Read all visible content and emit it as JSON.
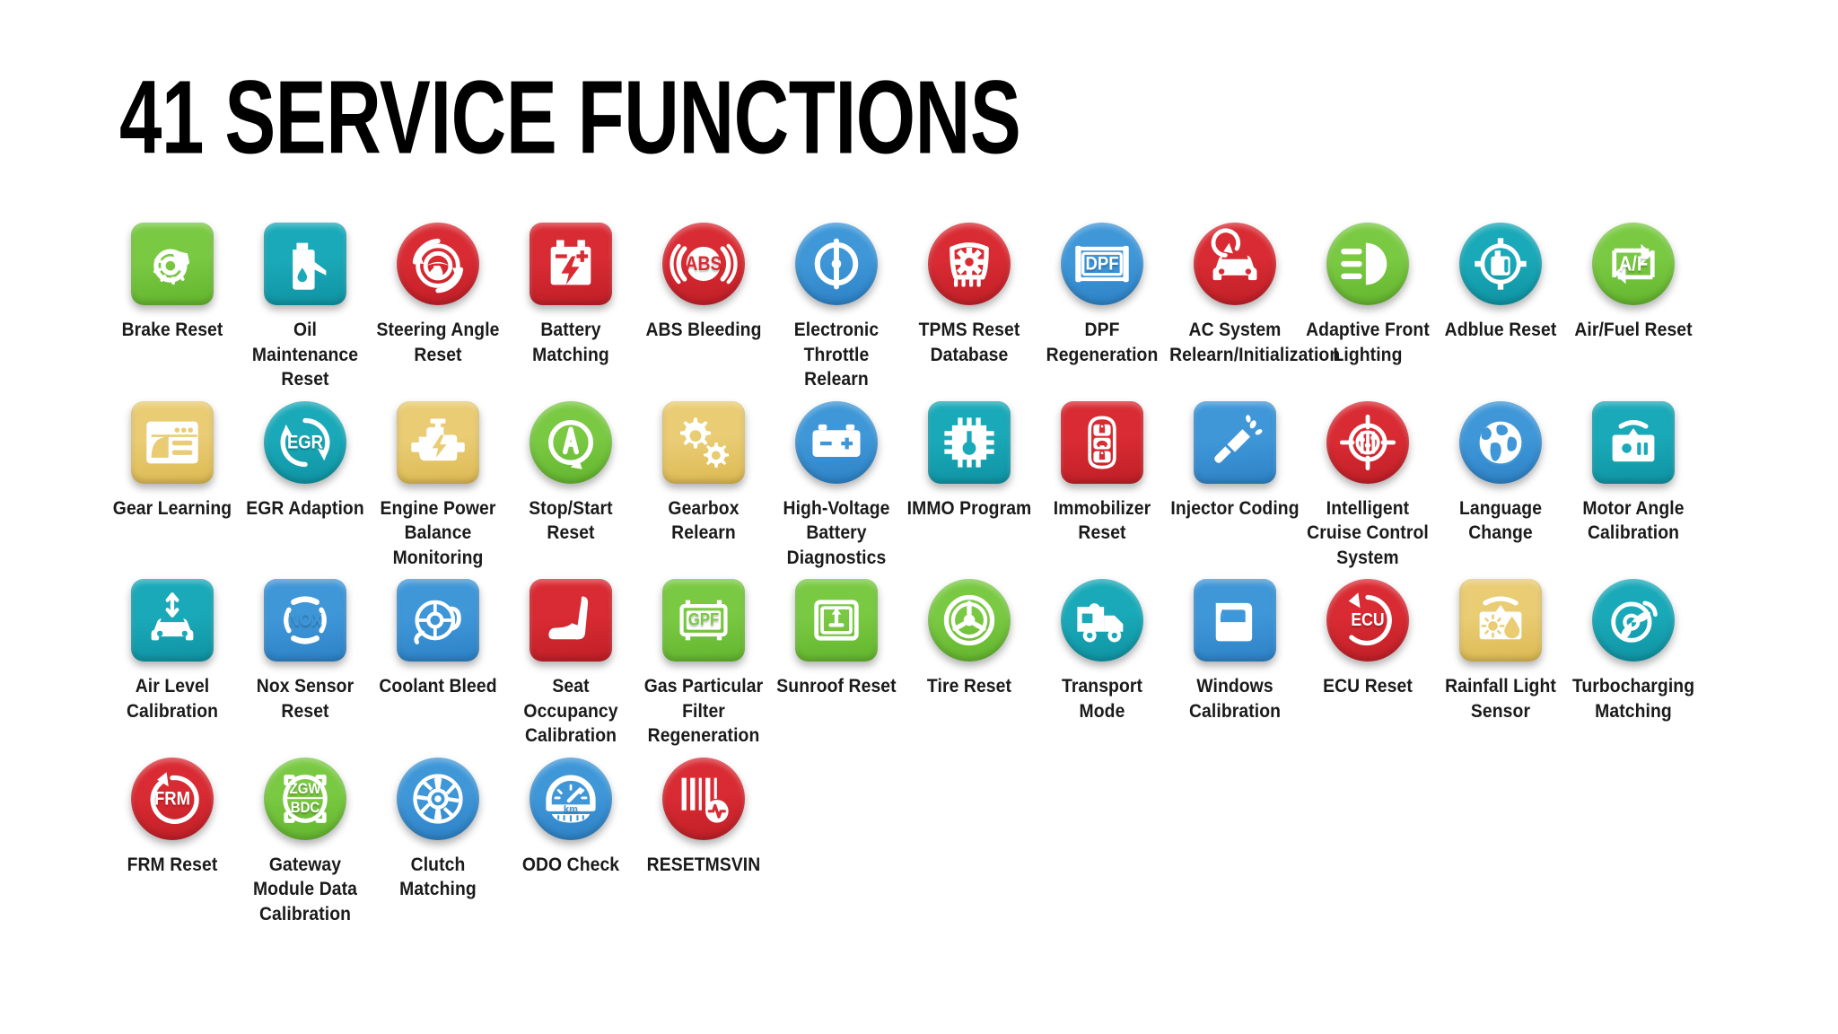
{
  "page": {
    "title": "41 SERVICE FUNCTIONS",
    "background": "#ffffff",
    "text_color": "#1a1a1a"
  },
  "palette": {
    "green": "#7ac943",
    "green_dark": "#63b52e",
    "blue": "#3f97d8",
    "blue_dark": "#2d82c6",
    "red": "#d92b33",
    "red_dark": "#c01f27",
    "teal": "#1aa9b8",
    "teal_dark": "#0f93a3",
    "gold": "#e9cc74",
    "gold_dark": "#dcb952",
    "glyph": "#ffffff"
  },
  "rows": [
    {
      "index": 1,
      "items": [
        {
          "label": "Brake Reset",
          "icon": "brake-disc-icon",
          "color": "green",
          "shape": "square"
        },
        {
          "label": "Oil Maintenance Reset",
          "icon": "oil-can-icon",
          "color": "teal",
          "shape": "square"
        },
        {
          "label": "Steering Angle Reset",
          "icon": "steering-wheel-reset-icon",
          "color": "red",
          "shape": "circle"
        },
        {
          "label": "Battery Matching",
          "icon": "battery-icon",
          "color": "red",
          "shape": "square"
        },
        {
          "label": "ABS Bleeding",
          "icon": "abs-icon",
          "color": "red",
          "shape": "circle",
          "text": "ABS"
        },
        {
          "label": "Electronic Throttle Relearn",
          "icon": "throttle-body-icon",
          "color": "blue",
          "shape": "circle"
        },
        {
          "label": "TPMS Reset Database",
          "icon": "tire-pressure-icon",
          "color": "red",
          "shape": "circle"
        },
        {
          "label": "DPF Regeneration",
          "icon": "dpf-filter-icon",
          "color": "blue",
          "shape": "circle",
          "text": "DPF"
        },
        {
          "label": "AC System Relearn/Initialization",
          "icon": "ac-car-icon",
          "color": "red",
          "shape": "circle"
        },
        {
          "label": "Adaptive Front Lighting",
          "icon": "headlight-icon",
          "color": "green",
          "shape": "circle"
        },
        {
          "label": "Adblue Reset",
          "icon": "adblue-tank-icon",
          "color": "teal",
          "shape": "circle"
        },
        {
          "label": "Air/Fuel Reset",
          "icon": "air-fuel-icon",
          "color": "green",
          "shape": "circle",
          "text": "A/F"
        }
      ]
    },
    {
      "index": 2,
      "items": [
        {
          "label": "Gear Learning",
          "icon": "gear-learning-screen-icon",
          "color": "gold",
          "shape": "square"
        },
        {
          "label": "EGR Adaption",
          "icon": "egr-icon",
          "color": "teal",
          "shape": "circle",
          "text": "EGR"
        },
        {
          "label": "Engine Power Balance Monitoring",
          "icon": "engine-power-icon",
          "color": "gold",
          "shape": "square"
        },
        {
          "label": "Stop/Start Reset",
          "icon": "auto-stop-start-icon",
          "color": "green",
          "shape": "circle",
          "text": "A"
        },
        {
          "label": "Gearbox Relearn",
          "icon": "gears-icon",
          "color": "gold",
          "shape": "square"
        },
        {
          "label": "High-Voltage Battery Diagnostics",
          "icon": "hv-battery-icon",
          "color": "blue",
          "shape": "circle"
        },
        {
          "label": "IMMO Program",
          "icon": "immo-chip-icon",
          "color": "teal",
          "shape": "square"
        },
        {
          "label": "Immobilizer Reset",
          "icon": "key-fob-icon",
          "color": "red",
          "shape": "square"
        },
        {
          "label": "Injector Coding",
          "icon": "injector-icon",
          "color": "blue",
          "shape": "square"
        },
        {
          "label": "Intelligent Cruise Control System",
          "icon": "cruise-target-icon",
          "color": "red",
          "shape": "circle"
        },
        {
          "label": "Language Change",
          "icon": "globe-icon",
          "color": "blue",
          "shape": "circle"
        },
        {
          "label": "Motor Angle Calibration",
          "icon": "motor-angle-icon",
          "color": "teal",
          "shape": "square"
        }
      ]
    },
    {
      "index": 3,
      "items": [
        {
          "label": "Air Level Calibration",
          "icon": "air-suspension-icon",
          "color": "teal",
          "shape": "square"
        },
        {
          "label": "Nox Sensor Reset",
          "icon": "nox-icon",
          "color": "blue",
          "shape": "square",
          "text": "NOX"
        },
        {
          "label": "Coolant Bleed",
          "icon": "coolant-pump-icon",
          "color": "blue",
          "shape": "square"
        },
        {
          "label": "Seat Occupancy Calibration",
          "icon": "car-seat-icon",
          "color": "red",
          "shape": "square"
        },
        {
          "label": "Gas Particular Filter Regeneration",
          "icon": "gpf-icon",
          "color": "green",
          "shape": "square",
          "text": "GPF"
        },
        {
          "label": "Sunroof Reset",
          "icon": "sunroof-icon",
          "color": "green",
          "shape": "square"
        },
        {
          "label": "Tire Reset",
          "icon": "tire-wheel-icon",
          "color": "green",
          "shape": "circle"
        },
        {
          "label": "Transport Mode",
          "icon": "transport-truck-icon",
          "color": "teal",
          "shape": "circle"
        },
        {
          "label": "Windows Calibration",
          "icon": "car-door-window-icon",
          "color": "blue",
          "shape": "square"
        },
        {
          "label": "ECU Reset",
          "icon": "ecu-reset-icon",
          "color": "red",
          "shape": "circle",
          "text": "ECU"
        },
        {
          "label": "Rainfall Light Sensor",
          "icon": "rain-light-sensor-icon",
          "color": "gold",
          "shape": "square"
        },
        {
          "label": "Turbocharging Matching",
          "icon": "turbocharger-icon",
          "color": "teal",
          "shape": "circle"
        }
      ]
    },
    {
      "index": 4,
      "items": [
        {
          "label": "FRM Reset",
          "icon": "frm-reset-icon",
          "color": "red",
          "shape": "circle",
          "text": "FRM"
        },
        {
          "label": "Gateway Module Data Calibration",
          "icon": "zgw-bdc-icon",
          "color": "green",
          "shape": "circle",
          "text": "ZGW/BDC"
        },
        {
          "label": "Clutch Matching",
          "icon": "clutch-icon",
          "color": "blue",
          "shape": "circle"
        },
        {
          "label": "ODO Check",
          "icon": "odometer-icon",
          "color": "blue",
          "shape": "circle",
          "text": "km"
        },
        {
          "label": "RESETMSVIN",
          "icon": "vin-barcode-icon",
          "color": "red",
          "shape": "circle"
        }
      ]
    }
  ]
}
